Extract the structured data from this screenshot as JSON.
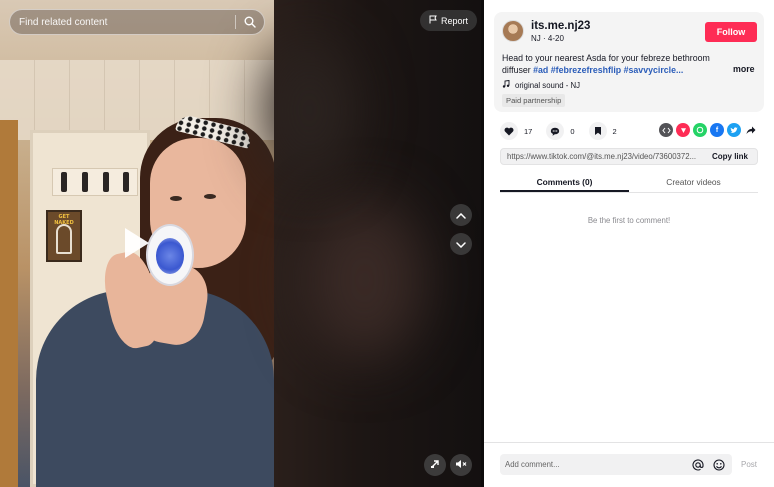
{
  "search": {
    "placeholder": "Find related content"
  },
  "report": {
    "label": "Report"
  },
  "video": {
    "poster_text": "GET NAKED",
    "icons": [
      "play-icon",
      "search-icon",
      "flag-icon",
      "chevron-up-icon",
      "chevron-down-icon",
      "picture-in-picture-icon",
      "volume-muted-icon"
    ]
  },
  "author": {
    "username": "its.me.nj23",
    "subline": "NJ · 4-20",
    "follow_label": "Follow"
  },
  "description": {
    "text": "Head to your nearest Asda for your febreze bethroom diffuser ",
    "tags": [
      "#ad",
      "#febrezefreshflip",
      "#savvycircle..."
    ],
    "more_label": "more"
  },
  "sound": {
    "label": "original sound - NJ"
  },
  "badge": {
    "paid": "Paid partnership"
  },
  "stats": {
    "likes": "17",
    "comments": "0",
    "saves": "2"
  },
  "share": {
    "icons": [
      "embed-icon",
      "friends-icon",
      "whatsapp-icon",
      "facebook-icon",
      "twitter-icon",
      "share-arrow-icon"
    ]
  },
  "link": {
    "url": "https://www.tiktok.com/@its.me.nj23/video/73600372...",
    "copy_label": "Copy link"
  },
  "tabs": [
    {
      "label": "Comments (0)",
      "active": true
    },
    {
      "label": "Creator videos",
      "active": false
    }
  ],
  "comments": {
    "empty_message": "Be the first to comment!"
  },
  "composer": {
    "placeholder": "Add comment...",
    "post_label": "Post"
  },
  "colors": {
    "accent": "#fe2c55",
    "hashtag": "#2b5db9",
    "text": "#161823"
  }
}
